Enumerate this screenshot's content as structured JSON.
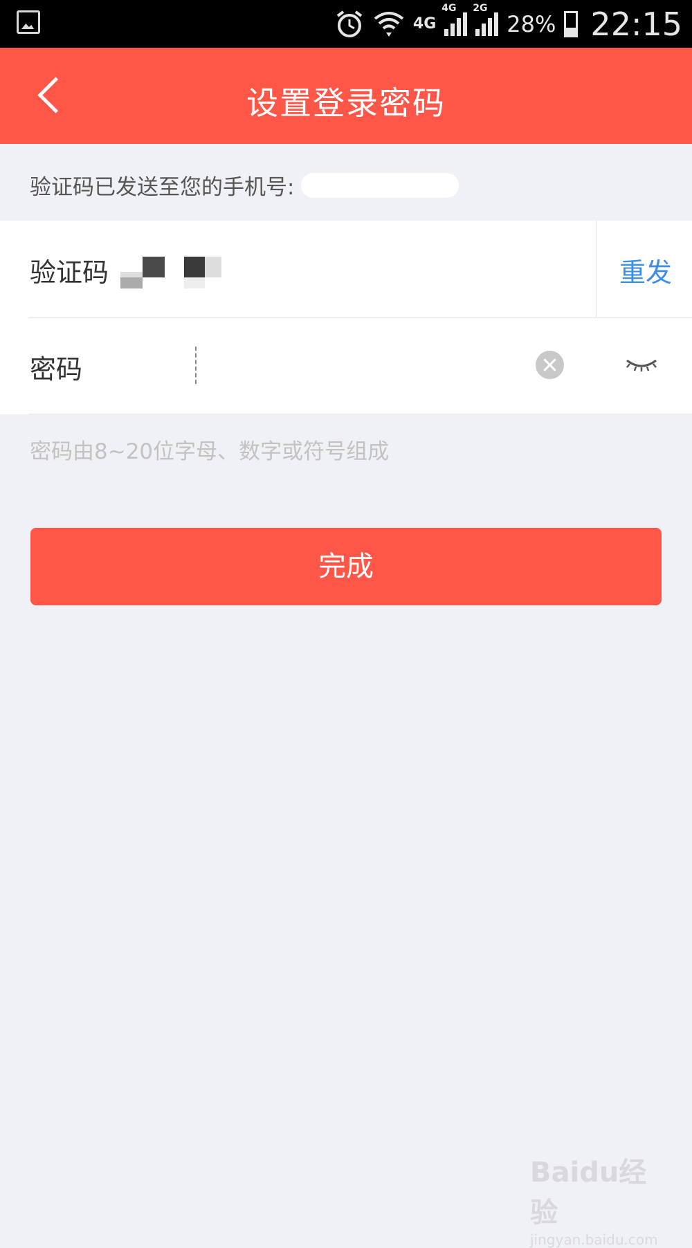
{
  "status_bar": {
    "network_4g": "4G",
    "signal1_label": "4G",
    "signal2_label": "2G",
    "battery": "28%",
    "time": "22:15"
  },
  "header": {
    "title": "设置登录密码"
  },
  "info": {
    "text": "验证码已发送至您的手机号:"
  },
  "form": {
    "code_label": "验证码",
    "resend_label": "重发",
    "password_label": "密码",
    "password_value": ""
  },
  "hint": "密码由8~20位字母、数字或符号组成",
  "submit_label": "完成",
  "watermark": {
    "main": "Baidu经验",
    "sub": "jingyan.baidu.com"
  },
  "colors": {
    "accent": "#ff5648",
    "link": "#3a8ee6",
    "background": "#f0f1f6"
  }
}
